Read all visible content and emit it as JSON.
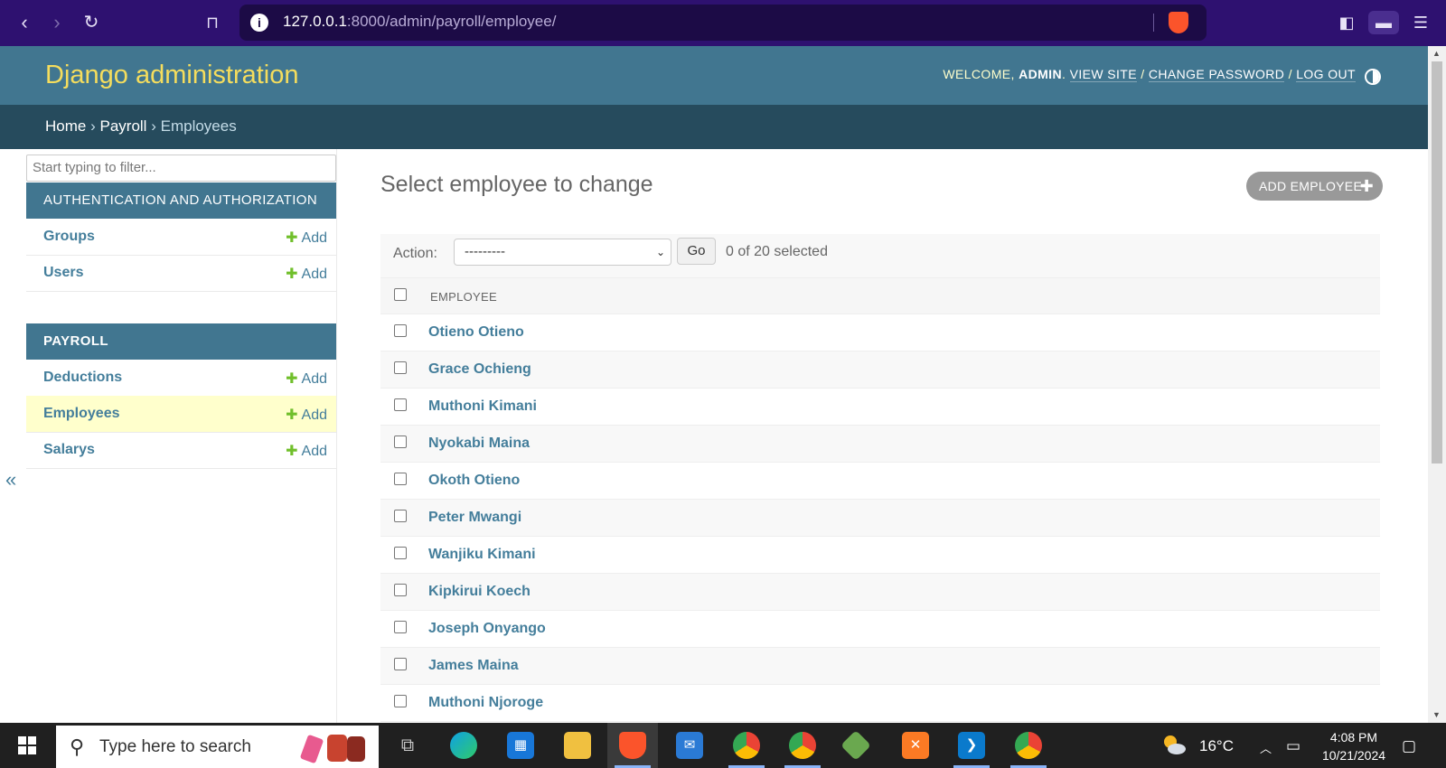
{
  "browser": {
    "url_host": "127.0.0.1",
    "url_rest": ":8000/admin/payroll/employee/"
  },
  "header": {
    "branding": "Django administration",
    "welcome": "WELCOME,",
    "username": "ADMIN",
    "view_site": "VIEW SITE",
    "change_password": "CHANGE PASSWORD",
    "log_out": "LOG OUT",
    "sep": "/"
  },
  "breadcrumbs": {
    "home": "Home",
    "app": "Payroll",
    "current": "Employees",
    "sep": "›"
  },
  "sidebar": {
    "filter_placeholder": "Start typing to filter...",
    "collapse": "«",
    "add_label": "Add",
    "apps": [
      {
        "caption": "AUTHENTICATION AND AUTHORIZATION",
        "models": [
          {
            "name": "Groups"
          },
          {
            "name": "Users"
          }
        ]
      },
      {
        "caption": "PAYROLL",
        "models": [
          {
            "name": "Deductions"
          },
          {
            "name": "Employees"
          },
          {
            "name": "Salarys"
          }
        ]
      }
    ]
  },
  "main": {
    "title": "Select employee to change",
    "add_button": "ADD EMPLOYEE",
    "action_label": "Action:",
    "action_value": "---------",
    "go": "Go",
    "selected_count": "0 of 20 selected",
    "column_header": "EMPLOYEE",
    "employees": [
      "Otieno Otieno",
      "Grace Ochieng",
      "Muthoni Kimani",
      "Nyokabi Maina",
      "Okoth Otieno",
      "Peter Mwangi",
      "Wanjiku Kimani",
      "Kipkirui Koech",
      "Joseph Onyango",
      "James Maina",
      "Muthoni Njoroge"
    ]
  },
  "taskbar": {
    "search_placeholder": "Type here to search",
    "temperature": "16°C",
    "time": "4:08 PM",
    "date": "10/21/2024"
  },
  "colors": {
    "header": "#417690",
    "breadcrumbs": "#264b5d",
    "branding": "#f5dd5d",
    "link": "#447e9b",
    "add_plus": "#70bf2b",
    "current_row": "#ffffcc"
  }
}
